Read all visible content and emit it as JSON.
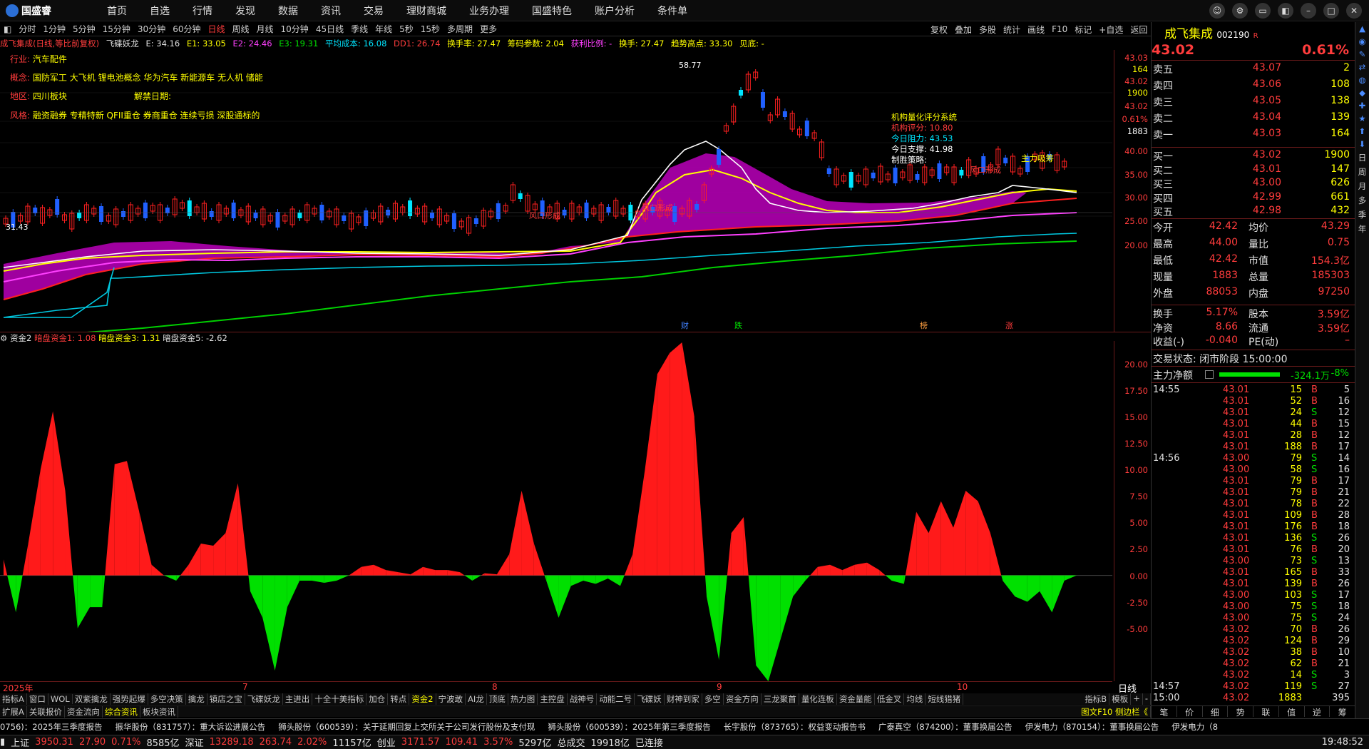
{
  "app": {
    "title": "国盛睿"
  },
  "nav": [
    "首页",
    "自选",
    "行情",
    "发现",
    "数据",
    "资讯",
    "交易",
    "理财商城",
    "业务办理",
    "国盛特色",
    "账户分析",
    "条件单"
  ],
  "periods": [
    "分时",
    "1分钟",
    "5分钟",
    "15分钟",
    "30分钟",
    "60分钟",
    "日线",
    "周线",
    "月线",
    "10分钟",
    "45日线",
    "季线",
    "年线",
    "5秒",
    "15秒",
    "多周期",
    "更多"
  ],
  "active_period": "日线",
  "tools": [
    "复权",
    "叠加",
    "多股",
    "统计",
    "画线",
    "F10",
    "标记",
    "+自选",
    "返回"
  ],
  "indicator": {
    "name": "成飞集成(日线,等比前复权)",
    "formula": "飞碟妖龙",
    "e": "E: 34.16",
    "e1": "E1: 33.05",
    "e2": "E2: 24.46",
    "e3": "E3: 19.31",
    "cost": "平均成本: 16.08",
    "dd1": "DD1: 26.74",
    "turnover": "换手率: 27.47",
    "chips": "筹码参数: 2.04",
    "profit": "获利比例: -",
    "hand": "换手: 27.47",
    "trend": "趋势高点: 33.30",
    "see": "见底: -"
  },
  "stock_info": {
    "industry_label": "行业:",
    "industry": "汽车配件",
    "concept_label": "概念:",
    "concept": "国防军工 大飞机 锂电池概念 华为汽车 新能源车 无人机 储能",
    "region_label": "地区:",
    "region": "四川板块",
    "unlock_label": "解禁日期:",
    "style_label": "风格:",
    "style": "融资融券 专精特新 QFII重仓 券商重仓 连续亏损 深股通标的"
  },
  "overlay_labels": {
    "peak": "58.77",
    "low": "31.43",
    "score_title": "机构量化评分系统",
    "score": "机构评分: 10.80",
    "resist": "今日阻力: 43.53",
    "support": "今日支撑: 41.98",
    "strategy": "制胜策略:",
    "main_buy": "主力吸筹",
    "wind1": "风口形成",
    "wind2": "风口形成",
    "wind3": "风口形成",
    "wind4": "风口形成"
  },
  "event_markers": [
    "财",
    "跌",
    "榜",
    "涨"
  ],
  "main_axis": [
    "43.03",
    "164",
    "43.02",
    "1900",
    "43.02",
    "0.61%",
    "1883",
    "40.00",
    "35.00",
    "30.00",
    "25.00",
    "20.00"
  ],
  "sub_head": {
    "name": "资金2",
    "a": "暗盘资金1: 1.08",
    "b": "暗盘资金3: 1.31",
    "c": "暗盘资金5: -2.62"
  },
  "sub_axis": [
    "20.00",
    "17.50",
    "15.00",
    "12.50",
    "10.00",
    "7.50",
    "5.00",
    "2.50",
    "0.00",
    "-2.50",
    "-5.00"
  ],
  "dates": [
    "2025年",
    "7",
    "8",
    "9",
    "10"
  ],
  "period_label": "日线",
  "chart_data": {
    "type": "area",
    "title": "资金2",
    "ylim": [
      -10,
      22
    ],
    "x_months": [
      "2025-06",
      "2025-07",
      "2025-08",
      "2025-09",
      "2025-10"
    ],
    "values": [
      1.5,
      -3.5,
      3,
      10,
      15.5,
      8,
      -5,
      -3,
      -3,
      10.5,
      10.8,
      6,
      1,
      0,
      -0.5,
      1,
      3,
      2.8,
      4,
      8.7,
      -1.5,
      -4,
      -9,
      -3,
      -0.5,
      -0.5,
      -0.7,
      -0.5,
      0,
      0.8,
      1,
      0.5,
      0.3,
      0.1,
      0.8,
      0.5,
      0.5,
      0.3,
      -0.5,
      0.2,
      0.1,
      2,
      8,
      3,
      -0.5,
      -4,
      -1,
      -0.5,
      -0.8,
      -0.3,
      -1,
      2,
      10,
      19,
      21,
      22,
      15,
      -2,
      -8,
      4,
      5.5,
      -8.5,
      -10,
      -6,
      -2,
      -0.5,
      0.8,
      1,
      0.5,
      1,
      1.2,
      0.5,
      -0.5,
      -0.8,
      6,
      4,
      7,
      4.5,
      8,
      7,
      4,
      -0.5,
      -2,
      -2.5,
      -1.5,
      -3.5,
      -0.5,
      0
    ]
  },
  "quote": {
    "name": "成飞集成",
    "code": "002190",
    "flag": "R",
    "price": "43.02",
    "change": "0.61%",
    "asks": [
      {
        "l": "卖五",
        "p": "43.07",
        "v": "2"
      },
      {
        "l": "卖四",
        "p": "43.06",
        "v": "108"
      },
      {
        "l": "卖三",
        "p": "43.05",
        "v": "138"
      },
      {
        "l": "卖二",
        "p": "43.04",
        "v": "139"
      },
      {
        "l": "卖一",
        "p": "43.03",
        "v": "164"
      }
    ],
    "bids": [
      {
        "l": "买一",
        "p": "43.02",
        "v": "1900"
      },
      {
        "l": "买二",
        "p": "43.01",
        "v": "147"
      },
      {
        "l": "买三",
        "p": "43.00",
        "v": "626"
      },
      {
        "l": "买四",
        "p": "42.99",
        "v": "661"
      },
      {
        "l": "买五",
        "p": "42.98",
        "v": "432"
      }
    ],
    "stats": [
      [
        "今开",
        "42.42",
        "均价",
        "43.29"
      ],
      [
        "最高",
        "44.00",
        "量比",
        "0.75"
      ],
      [
        "最低",
        "42.42",
        "市值",
        "154.3亿"
      ],
      [
        "现量",
        "1883",
        "总量",
        "185303"
      ],
      [
        "外盘",
        "88053",
        "内盘",
        "97250"
      ]
    ],
    "stats2": [
      [
        "换手",
        "5.17%",
        "股本",
        "3.59亿"
      ],
      [
        "净资",
        "8.66",
        "流通",
        "3.59亿"
      ],
      [
        "收益(-)",
        "-0.040",
        "PE(动)",
        "–"
      ]
    ],
    "trade_state": "交易状态: 闭市阶段 15:00:00",
    "main_flow_label": "主力净额",
    "main_flow": "-324.1万",
    "main_pct": "-8%"
  },
  "ticks": [
    [
      "14:55",
      "43.01",
      "15",
      "B",
      "5"
    ],
    [
      "",
      "43.01",
      "52",
      "B",
      "16"
    ],
    [
      "",
      "43.01",
      "24",
      "S",
      "12"
    ],
    [
      "",
      "43.01",
      "44",
      "B",
      "15"
    ],
    [
      "",
      "43.01",
      "28",
      "B",
      "12"
    ],
    [
      "",
      "43.01",
      "188",
      "B",
      "17"
    ],
    [
      "14:56",
      "43.00",
      "79",
      "S",
      "14"
    ],
    [
      "",
      "43.00",
      "58",
      "S",
      "16"
    ],
    [
      "",
      "43.01",
      "79",
      "B",
      "17"
    ],
    [
      "",
      "43.01",
      "79",
      "B",
      "21"
    ],
    [
      "",
      "43.01",
      "78",
      "B",
      "22"
    ],
    [
      "",
      "43.01",
      "109",
      "B",
      "28"
    ],
    [
      "",
      "43.01",
      "176",
      "B",
      "18"
    ],
    [
      "",
      "43.01",
      "136",
      "S",
      "26"
    ],
    [
      "",
      "43.01",
      "76",
      "B",
      "20"
    ],
    [
      "",
      "43.00",
      "73",
      "S",
      "13"
    ],
    [
      "",
      "43.01",
      "165",
      "B",
      "33"
    ],
    [
      "",
      "43.01",
      "139",
      "B",
      "26"
    ],
    [
      "",
      "43.00",
      "103",
      "S",
      "17"
    ],
    [
      "",
      "43.00",
      "75",
      "S",
      "18"
    ],
    [
      "",
      "43.00",
      "75",
      "S",
      "24"
    ],
    [
      "",
      "43.02",
      "70",
      "B",
      "26"
    ],
    [
      "",
      "43.02",
      "124",
      "B",
      "29"
    ],
    [
      "",
      "43.02",
      "38",
      "B",
      "10"
    ],
    [
      "",
      "43.02",
      "62",
      "B",
      "21"
    ],
    [
      "",
      "43.02",
      "14",
      "S",
      "3"
    ],
    [
      "14:57",
      "43.02",
      "119",
      "S",
      "27"
    ],
    [
      "15:00",
      "43.02",
      "1883",
      "",
      "395"
    ]
  ],
  "rside": [
    "日",
    "周",
    "月",
    "多",
    "季",
    "年"
  ],
  "tabs1": [
    "指标A",
    "窗口",
    "WOL",
    "双紫擒龙",
    "强势起爆",
    "多空决策",
    "擒龙",
    "镇店之宝",
    "飞碟妖龙",
    "主进出",
    "十全十美指标",
    "加仓",
    "转点",
    "资金2",
    "宁波敢",
    "AI龙",
    "顶底",
    "热力图",
    "主控盘",
    "战神号",
    "动能二号",
    "飞碟妖",
    "财神到家",
    "多空",
    "资金方向",
    "三龙聚首",
    "量化连板",
    "资金量能",
    "低金叉",
    "均线",
    "短线猎猪"
  ],
  "tabs1_right": [
    "指标B",
    "模板",
    "+",
    "-"
  ],
  "tabs2": [
    "扩展A",
    "关联报价",
    "资金流向",
    "综合资讯",
    "板块资讯"
  ],
  "tabs2_right": "图文F10 侧边栏《",
  "tabs2_active": "综合资讯",
  "quote_tabs": [
    "笔",
    "价",
    "细",
    "势",
    "联",
    "值",
    "逆",
    "筹"
  ],
  "news": [
    "0756)：2025年三季度报告",
    "振华股份（831757）：重大诉讼进展公告",
    "狮头股份（600539）：关于延期回复上交所关于公司发行股份及支付现",
    "狮头股份（600539）：2025年第三季度报告",
    "长宇股份（873765）：权益变动报告书",
    "广泰真空（874200）：董事换届公告",
    "伊发电力（870154）：董事换届公告",
    "伊发电力（8"
  ],
  "status": {
    "sh": "上证",
    "sh_val": "3950.31",
    "sh_chg": "27.90",
    "sh_pct": "0.71%",
    "sh_amt": "8585亿",
    "sz": "深证",
    "sz_val": "13289.18",
    "sz_chg": "263.74",
    "sz_pct": "2.02%",
    "sz_amt": "11157亿",
    "cy": "创业",
    "cy_val": "3171.57",
    "cy_chg": "109.41",
    "cy_pct": "3.57%",
    "cy_amt": "5297亿",
    "total": "总成交",
    "total_val": "19918亿",
    "conn": "已连接",
    "time": "19:48:52"
  }
}
